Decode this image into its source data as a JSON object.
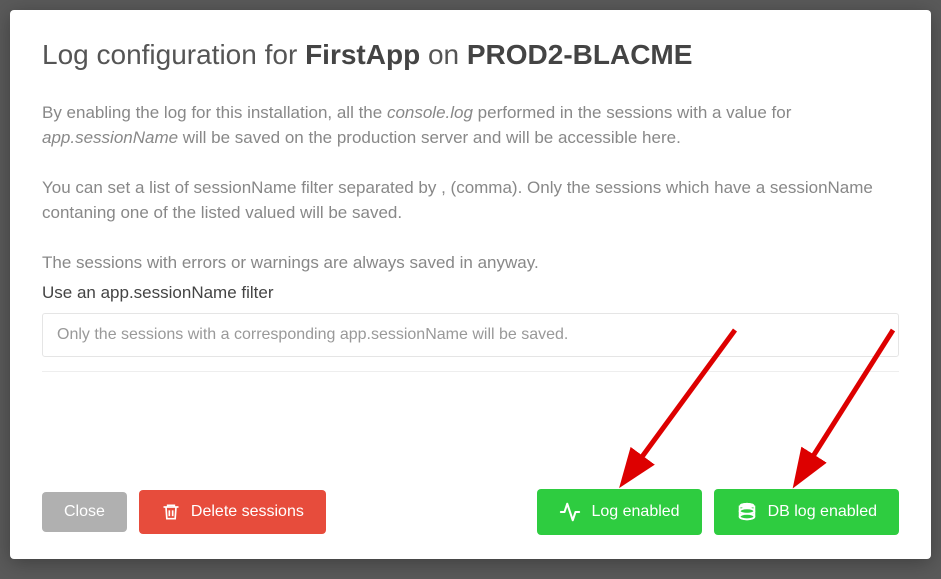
{
  "title_prefix": "Log configuration for ",
  "title_app": "FirstApp",
  "title_on": " on ",
  "title_server": "PROD2-BLACME",
  "paragraph1_a": "By enabling the log for this installation, all the ",
  "paragraph1_em1": "console.log",
  "paragraph1_b": " performed in the sessions with a value for ",
  "paragraph1_em2": "app.sessionName",
  "paragraph1_c": " will be saved on the production server and will be accessible here.",
  "paragraph2": "You can set a list of sessionName filter separated by , (comma). Only the sessions which have a sessionName contaning one of the listed valued will be saved.",
  "paragraph3": "The sessions with errors or warnings are always saved in anyway.",
  "filter_label": "Use an app.sessionName filter",
  "filter_placeholder": "Only the sessions with a corresponding app.sessionName will be saved.",
  "btn_close": "Close",
  "btn_delete": "Delete sessions",
  "btn_log": "Log enabled",
  "btn_dblog": "DB log enabled"
}
